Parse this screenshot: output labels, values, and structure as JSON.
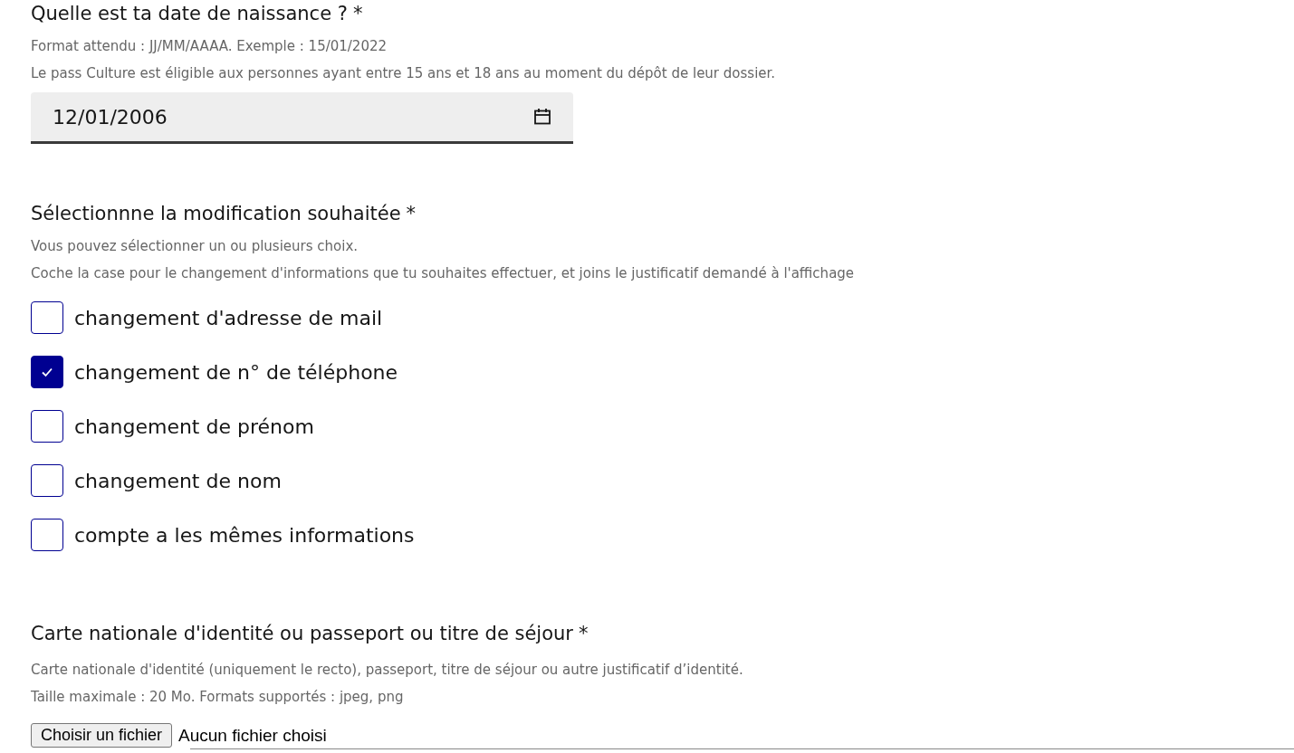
{
  "birthdate": {
    "label": "Quelle est ta date de naissance ?",
    "required_mark": "*",
    "hints": [
      "Format attendu : JJ/MM/AAAA. Exemple : 15/01/2022",
      "Le pass Culture est éligible aux personnes ayant entre 15 ans et 18 ans au moment du dépôt de leur dossier."
    ],
    "value": "12/01/2006"
  },
  "modification": {
    "label": "Sélectionnne la modification souhaitée",
    "required_mark": "*",
    "hints": [
      "Vous pouvez sélectionner un ou plusieurs choix.",
      "Coche la case pour le changement d'informations que tu souhaites effectuer, et joins le justificatif demandé à l'affichage"
    ],
    "options": [
      {
        "label": "changement d'adresse de mail",
        "checked": false
      },
      {
        "label": "changement de n° de téléphone",
        "checked": true
      },
      {
        "label": "changement de prénom",
        "checked": false
      },
      {
        "label": "changement de nom",
        "checked": false
      },
      {
        "label": "compte a les mêmes informations",
        "checked": false
      }
    ]
  },
  "identity": {
    "label": "Carte nationale d'identité ou passeport ou titre de séjour",
    "required_mark": "*",
    "hints": [
      "Carte nationale d'identité (uniquement le recto), passeport, titre de séjour ou autre justificatif d’identité.",
      "Taille maximale : 20 Mo. Formats supportés : jpeg, png"
    ],
    "button": "Choisir un fichier",
    "status": "Aucun fichier choisi"
  }
}
